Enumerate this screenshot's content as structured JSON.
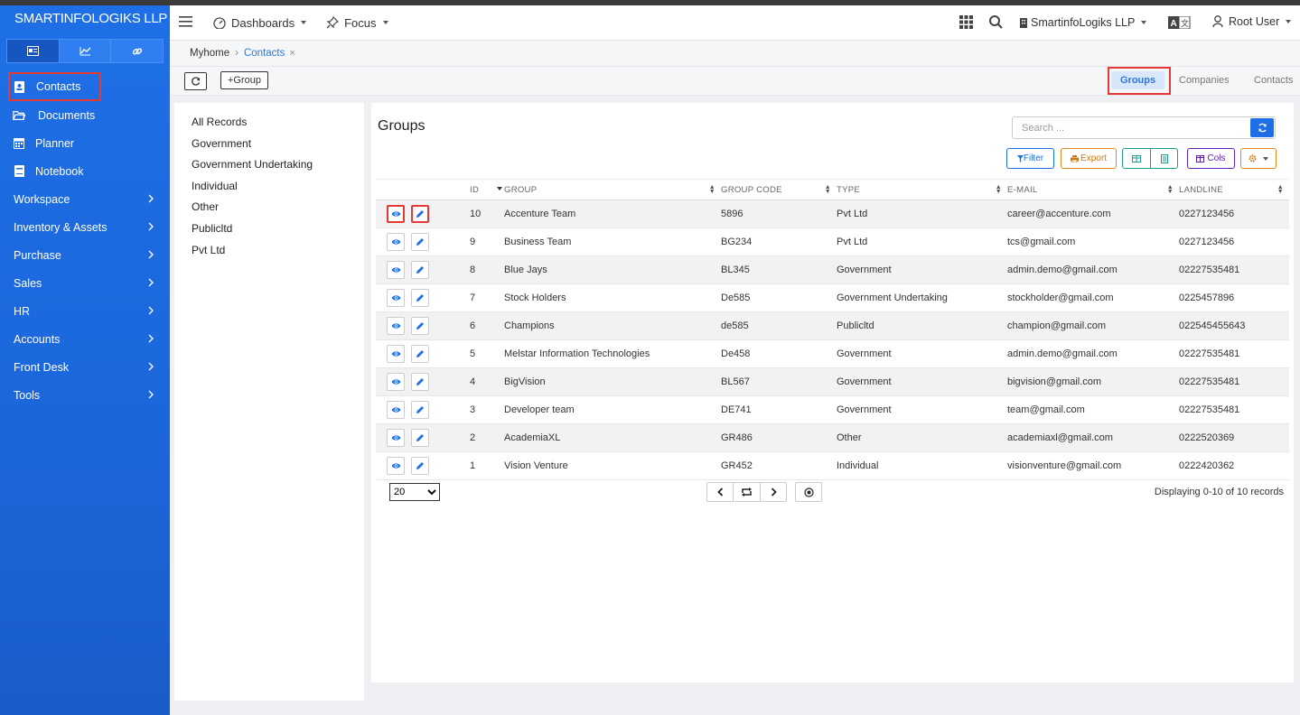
{
  "brand": "SMARTINFOLOGIKS LLP",
  "sidebar": {
    "items": [
      {
        "label": "Contacts",
        "icon": "contacts-icon"
      },
      {
        "label": "Documents",
        "icon": "folder-icon"
      },
      {
        "label": "Planner",
        "icon": "calendar-icon"
      },
      {
        "label": "Notebook",
        "icon": "notebook-icon"
      },
      {
        "label": "Workspace"
      },
      {
        "label": "Inventory & Assets"
      },
      {
        "label": "Purchase"
      },
      {
        "label": "Sales"
      },
      {
        "label": "HR"
      },
      {
        "label": "Accounts"
      },
      {
        "label": "Front Desk"
      },
      {
        "label": "Tools"
      }
    ]
  },
  "topbar": {
    "dashboards": "Dashboards",
    "focus": "Focus",
    "company": "SmartinfoLogiks LLP",
    "user": "Root User"
  },
  "breadcrumb": {
    "home": "Myhome",
    "current": "Contacts",
    "close": "×"
  },
  "toolbar": {
    "group_btn": "+Group",
    "tabs": [
      "Groups",
      "Companies",
      "Contacts"
    ]
  },
  "groups_list": [
    "All Records",
    "Government",
    "Government Undertaking",
    "Individual",
    "Other",
    "Publicltd",
    "Pvt Ltd"
  ],
  "main": {
    "title": "Groups",
    "search_placeholder": "Search ...",
    "filter": "Filter",
    "export": "Export",
    "cols": "Cols",
    "columns": [
      "ID",
      "GROUP",
      "GROUP CODE",
      "TYPE",
      "E-MAIL",
      "LANDLINE"
    ],
    "rows": [
      {
        "id": "10",
        "group": "Accenture Team",
        "code": "5896",
        "type": "Pvt Ltd",
        "email": "career@accenture.com",
        "landline": "0227123456"
      },
      {
        "id": "9",
        "group": "Business Team",
        "code": "BG234",
        "type": "Pvt Ltd",
        "email": "tcs@gmail.com",
        "landline": "0227123456"
      },
      {
        "id": "8",
        "group": "Blue Jays",
        "code": "BL345",
        "type": "Government",
        "email": "admin.demo@gmail.com",
        "landline": "02227535481"
      },
      {
        "id": "7",
        "group": "Stock Holders",
        "code": "De585",
        "type": "Government Undertaking",
        "email": "stockholder@gmail.com",
        "landline": "0225457896"
      },
      {
        "id": "6",
        "group": "Champions",
        "code": "de585",
        "type": "Publicltd",
        "email": "champion@gmail.com",
        "landline": "022545455643"
      },
      {
        "id": "5",
        "group": "Melstar Information Technologies",
        "code": "De458",
        "type": "Government",
        "email": "admin.demo@gmail.com",
        "landline": "02227535481"
      },
      {
        "id": "4",
        "group": "BigVision",
        "code": "BL567",
        "type": "Government",
        "email": "bigvision@gmail.com",
        "landline": "02227535481"
      },
      {
        "id": "3",
        "group": "Developer team",
        "code": "DE741",
        "type": "Government",
        "email": "team@gmail.com",
        "landline": "02227535481"
      },
      {
        "id": "2",
        "group": "AcademiaXL",
        "code": "GR486",
        "type": "Other",
        "email": "academiaxl@gmail.com",
        "landline": "0222520369"
      },
      {
        "id": "1",
        "group": "Vision Venture",
        "code": "GR452",
        "type": "Individual",
        "email": "visionventure@gmail.com",
        "landline": "0222420362"
      }
    ],
    "page_size": "20",
    "display": "Displaying 0-10 of 10 records"
  }
}
